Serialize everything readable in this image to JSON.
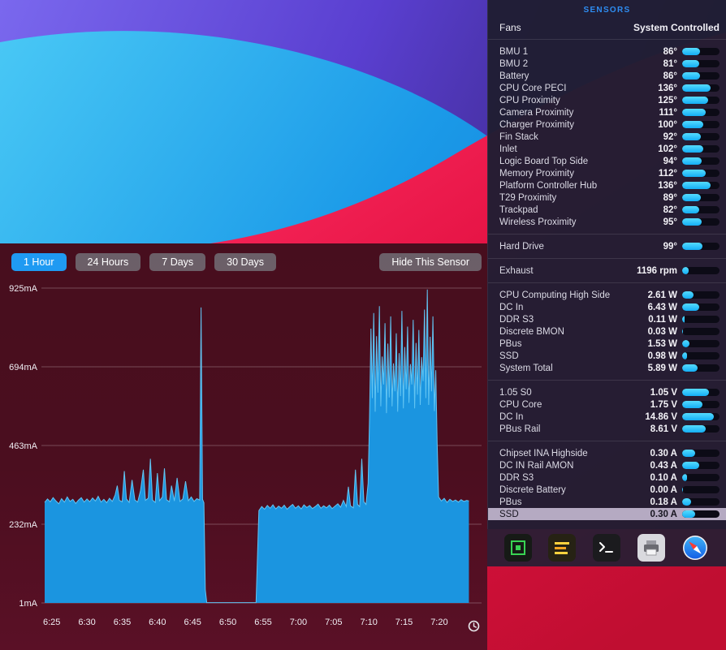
{
  "colors": {
    "accent_blue": "#1f9af2",
    "bar_fill": "#2ec6fb",
    "chart_area": "#1b95e0",
    "chart_line": "#62c4f2",
    "chart_bg": "#490f1f",
    "panel_bg": "#201e33",
    "highlight_bg": "#b5aac2",
    "wallpaper_red": "#e41243",
    "wallpaper_blue": "#1b9ae8",
    "wallpaper_purple": "#5a3fd0"
  },
  "chart_panel": {
    "range_buttons": [
      {
        "label": "1 Hour",
        "active": true
      },
      {
        "label": "24 Hours",
        "active": false
      },
      {
        "label": "7 Days",
        "active": false
      },
      {
        "label": "30 Days",
        "active": false
      }
    ],
    "hide_button_label": "Hide This Sensor"
  },
  "sensors_panel": {
    "title": "SENSORS",
    "fans": {
      "label": "Fans",
      "value": "System Controlled"
    },
    "groups": [
      {
        "rows": [
          {
            "label": "BMU 1",
            "value": "86°",
            "bar": 0.48
          },
          {
            "label": "BMU 2",
            "value": "81°",
            "bar": 0.45
          },
          {
            "label": "Battery",
            "value": "86°",
            "bar": 0.48
          },
          {
            "label": "CPU Core PECI",
            "value": "136°",
            "bar": 0.76
          },
          {
            "label": "CPU Proximity",
            "value": "125°",
            "bar": 0.69
          },
          {
            "label": "Camera Proximity",
            "value": "111°",
            "bar": 0.62
          },
          {
            "label": "Charger Proximity",
            "value": "100°",
            "bar": 0.56
          },
          {
            "label": "Fin Stack",
            "value": "92°",
            "bar": 0.51
          },
          {
            "label": "Inlet",
            "value": "102°",
            "bar": 0.57
          },
          {
            "label": "Logic Board Top Side",
            "value": "94°",
            "bar": 0.52
          },
          {
            "label": "Memory Proximity",
            "value": "112°",
            "bar": 0.62
          },
          {
            "label": "Platform Controller Hub",
            "value": "136°",
            "bar": 0.76
          },
          {
            "label": "T29 Proximity",
            "value": "89°",
            "bar": 0.49
          },
          {
            "label": "Trackpad",
            "value": "82°",
            "bar": 0.46
          },
          {
            "label": "Wireless Proximity",
            "value": "95°",
            "bar": 0.53
          }
        ]
      },
      {
        "rows": [
          {
            "label": "Hard Drive",
            "value": "99°",
            "bar": 0.55
          }
        ]
      },
      {
        "rows": [
          {
            "label": "Exhaust",
            "value": "1196 rpm",
            "bar": 0.18
          }
        ]
      },
      {
        "rows": [
          {
            "label": "CPU Computing High Side",
            "value": "2.61 W",
            "bar": 0.3
          },
          {
            "label": "DC In",
            "value": "6.43 W",
            "bar": 0.45
          },
          {
            "label": "DDR S3",
            "value": "0.11 W",
            "bar": 0.06
          },
          {
            "label": "Discrete BMON",
            "value": "0.03 W",
            "bar": 0.03
          },
          {
            "label": "PBus",
            "value": "1.53 W",
            "bar": 0.2
          },
          {
            "label": "SSD",
            "value": "0.98 W",
            "bar": 0.14
          },
          {
            "label": "System Total",
            "value": "5.89 W",
            "bar": 0.42
          }
        ]
      },
      {
        "rows": [
          {
            "label": "1.05 S0",
            "value": "1.05 V",
            "bar": 0.72
          },
          {
            "label": "CPU Core",
            "value": "1.75 V",
            "bar": 0.55
          },
          {
            "label": "DC In",
            "value": "14.86 V",
            "bar": 0.85
          },
          {
            "label": "PBus Rail",
            "value": "8.61 V",
            "bar": 0.62
          }
        ]
      },
      {
        "rows": [
          {
            "label": "Chipset INA Highside",
            "value": "0.30 A",
            "bar": 0.35
          },
          {
            "label": "DC IN Rail AMON",
            "value": "0.43 A",
            "bar": 0.45
          },
          {
            "label": "DDR S3",
            "value": "0.10 A",
            "bar": 0.14
          },
          {
            "label": "Discrete Battery",
            "value": "0.00 A",
            "bar": 0.02
          },
          {
            "label": "PBus",
            "value": "0.18 A",
            "bar": 0.24
          },
          {
            "label": "SSD",
            "value": "0.30 A",
            "bar": 0.35,
            "highlight": true
          }
        ]
      }
    ]
  },
  "dock": {
    "items": [
      {
        "icon": "circuit-app-icon"
      },
      {
        "icon": "warning-app-icon"
      },
      {
        "icon": "terminal-icon"
      },
      {
        "icon": "printer-icon"
      },
      {
        "icon": "safari-icon"
      }
    ]
  },
  "chart_data": {
    "type": "area",
    "title": "",
    "series_name": "SSD current",
    "unit": "mA",
    "grid": true,
    "legend": "none",
    "y_axis": {
      "tick_labels": [
        "925mA",
        "694mA",
        "463mA",
        "232mA",
        "1mA"
      ],
      "tick_values": [
        925,
        694,
        463,
        232,
        1
      ],
      "range": [
        1,
        925
      ]
    },
    "x_axis": {
      "tick_labels": [
        "6:25",
        "6:30",
        "6:35",
        "6:40",
        "6:45",
        "6:50",
        "6:55",
        "7:00",
        "7:05",
        "7:10",
        "7:15",
        "7:20"
      ],
      "tick_minutes": [
        1,
        6,
        11,
        16,
        21,
        26,
        31,
        36,
        41,
        46,
        51,
        56
      ],
      "domain_minutes": [
        0,
        62
      ]
    },
    "points": [
      [
        0,
        296
      ],
      [
        0.4,
        306
      ],
      [
        0.8,
        298
      ],
      [
        1.2,
        310
      ],
      [
        1.6,
        300
      ],
      [
        2,
        292
      ],
      [
        2.4,
        307
      ],
      [
        2.8,
        297
      ],
      [
        3.2,
        312
      ],
      [
        3.6,
        299
      ],
      [
        4,
        305
      ],
      [
        4.4,
        293
      ],
      [
        4.8,
        303
      ],
      [
        5.2,
        310
      ],
      [
        5.6,
        297
      ],
      [
        6,
        306
      ],
      [
        6.4,
        298
      ],
      [
        6.8,
        309
      ],
      [
        7.2,
        300
      ],
      [
        7.6,
        314
      ],
      [
        8,
        297
      ],
      [
        8.4,
        305
      ],
      [
        8.8,
        295
      ],
      [
        9.2,
        308
      ],
      [
        9.6,
        299
      ],
      [
        10,
        318
      ],
      [
        10.3,
        345
      ],
      [
        10.6,
        302
      ],
      [
        11,
        298
      ],
      [
        11.3,
        388
      ],
      [
        11.6,
        306
      ],
      [
        12,
        296
      ],
      [
        12.4,
        362
      ],
      [
        12.8,
        303
      ],
      [
        13.2,
        297
      ],
      [
        13.6,
        330
      ],
      [
        14,
        392
      ],
      [
        14.3,
        302
      ],
      [
        14.7,
        309
      ],
      [
        15,
        424
      ],
      [
        15.3,
        303
      ],
      [
        15.7,
        296
      ],
      [
        16,
        382
      ],
      [
        16.3,
        301
      ],
      [
        16.7,
        312
      ],
      [
        17,
        396
      ],
      [
        17.3,
        304
      ],
      [
        17.7,
        298
      ],
      [
        18,
        345
      ],
      [
        18.4,
        300
      ],
      [
        18.8,
        368
      ],
      [
        19.2,
        299
      ],
      [
        19.6,
        306
      ],
      [
        20,
        358
      ],
      [
        20.4,
        301
      ],
      [
        20.8,
        312
      ],
      [
        21.2,
        299
      ],
      [
        21.6,
        307
      ],
      [
        22,
        303
      ],
      [
        22.2,
        868
      ],
      [
        22.4,
        305
      ],
      [
        22.6,
        295
      ],
      [
        22.8,
        40
      ],
      [
        23,
        2
      ],
      [
        26,
        2
      ],
      [
        30,
        2
      ],
      [
        30.4,
        272
      ],
      [
        30.8,
        284
      ],
      [
        31.2,
        276
      ],
      [
        31.6,
        287
      ],
      [
        32,
        279
      ],
      [
        32.4,
        289
      ],
      [
        32.8,
        277
      ],
      [
        33.2,
        285
      ],
      [
        33.6,
        279
      ],
      [
        34,
        288
      ],
      [
        34.4,
        276
      ],
      [
        34.8,
        284
      ],
      [
        35.2,
        290
      ],
      [
        35.6,
        279
      ],
      [
        36,
        286
      ],
      [
        36.4,
        277
      ],
      [
        36.8,
        289
      ],
      [
        37.2,
        281
      ],
      [
        37.6,
        287
      ],
      [
        38,
        278
      ],
      [
        38.4,
        284
      ],
      [
        38.8,
        291
      ],
      [
        39.2,
        279
      ],
      [
        39.6,
        286
      ],
      [
        40,
        280
      ],
      [
        40.4,
        288
      ],
      [
        40.8,
        278
      ],
      [
        41.2,
        285
      ],
      [
        41.6,
        292
      ],
      [
        42,
        282
      ],
      [
        42.4,
        302
      ],
      [
        42.8,
        284
      ],
      [
        43.1,
        342
      ],
      [
        43.4,
        286
      ],
      [
        43.8,
        280
      ],
      [
        44.1,
        392
      ],
      [
        44.4,
        290
      ],
      [
        44.7,
        284
      ],
      [
        45,
        424
      ],
      [
        45.3,
        298
      ],
      [
        45.6,
        290
      ],
      [
        45.9,
        352
      ],
      [
        46.1,
        540
      ],
      [
        46.3,
        806
      ],
      [
        46.5,
        602
      ],
      [
        46.7,
        852
      ],
      [
        46.9,
        562
      ],
      [
        47.1,
        784
      ],
      [
        47.3,
        618
      ],
      [
        47.5,
        872
      ],
      [
        47.7,
        578
      ],
      [
        47.9,
        724
      ],
      [
        48.1,
        642
      ],
      [
        48.3,
        822
      ],
      [
        48.5,
        558
      ],
      [
        48.7,
        762
      ],
      [
        48.9,
        604
      ],
      [
        49.1,
        842
      ],
      [
        49.3,
        578
      ],
      [
        49.5,
        704
      ],
      [
        49.7,
        622
      ],
      [
        49.9,
        792
      ],
      [
        50.1,
        562
      ],
      [
        50.3,
        734
      ],
      [
        50.5,
        608
      ],
      [
        50.7,
        858
      ],
      [
        50.9,
        572
      ],
      [
        51.1,
        752
      ],
      [
        51.3,
        628
      ],
      [
        51.5,
        812
      ],
      [
        51.7,
        588
      ],
      [
        51.9,
        702
      ],
      [
        52.1,
        642
      ],
      [
        52.3,
        832
      ],
      [
        52.5,
        572
      ],
      [
        52.7,
        764
      ],
      [
        52.9,
        612
      ],
      [
        53.1,
        802
      ],
      [
        53.3,
        582
      ],
      [
        53.5,
        722
      ],
      [
        53.7,
        652
      ],
      [
        53.9,
        862
      ],
      [
        54.1,
        602
      ],
      [
        54.3,
        921
      ],
      [
        54.5,
        582
      ],
      [
        54.7,
        782
      ],
      [
        54.9,
        622
      ],
      [
        55.1,
        842
      ],
      [
        55.3,
        564
      ],
      [
        55.5,
        684
      ],
      [
        55.7,
        472
      ],
      [
        55.9,
        312
      ],
      [
        56.3,
        300
      ],
      [
        56.7,
        308
      ],
      [
        57.1,
        296
      ],
      [
        57.5,
        305
      ],
      [
        57.9,
        299
      ],
      [
        58.3,
        303
      ],
      [
        58.7,
        297
      ],
      [
        59.1,
        304
      ],
      [
        59.5,
        299
      ],
      [
        59.9,
        302
      ],
      [
        60.2,
        300
      ]
    ]
  }
}
